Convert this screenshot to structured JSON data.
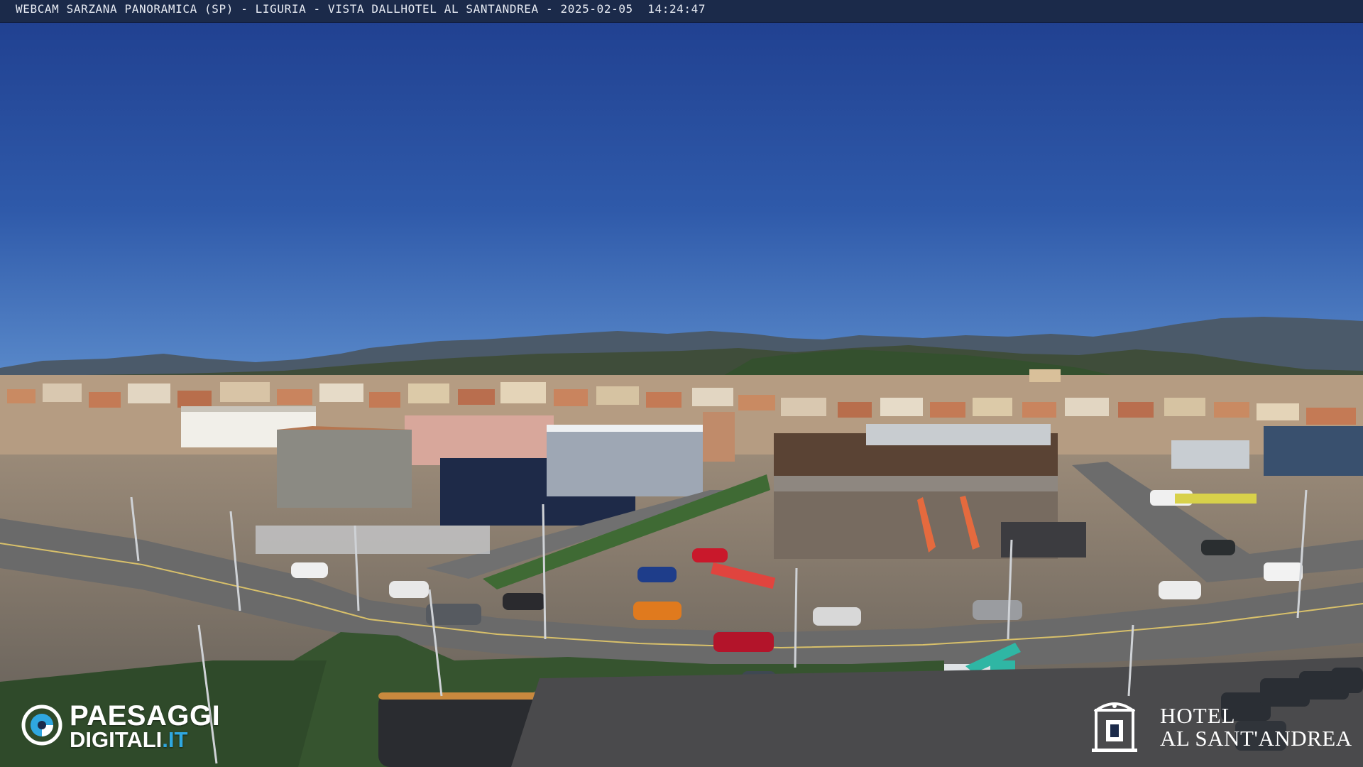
{
  "header": {
    "caption": "WEBCAM SARZANA PANORAMICA (SP) - LIGURIA - VISTA DALLHOTEL AL SANTANDREA - 2025-02-05  14:24:47"
  },
  "watermark_left": {
    "line1": "PAESAGGI",
    "line2_main": "DIGITALI",
    "line2_suffix": ".IT",
    "icon": "eye-icon"
  },
  "watermark_right": {
    "line1": "HOTEL",
    "line2": "AL SANT'ANDREA",
    "icon": "hotel-building-icon"
  },
  "colors": {
    "sky_top": "#1f3e8e",
    "sky_bottom": "#4f7fc6",
    "hills": "#3d4a4c",
    "road": "#6e6e6e",
    "brand_blue": "#2fa7e0"
  }
}
